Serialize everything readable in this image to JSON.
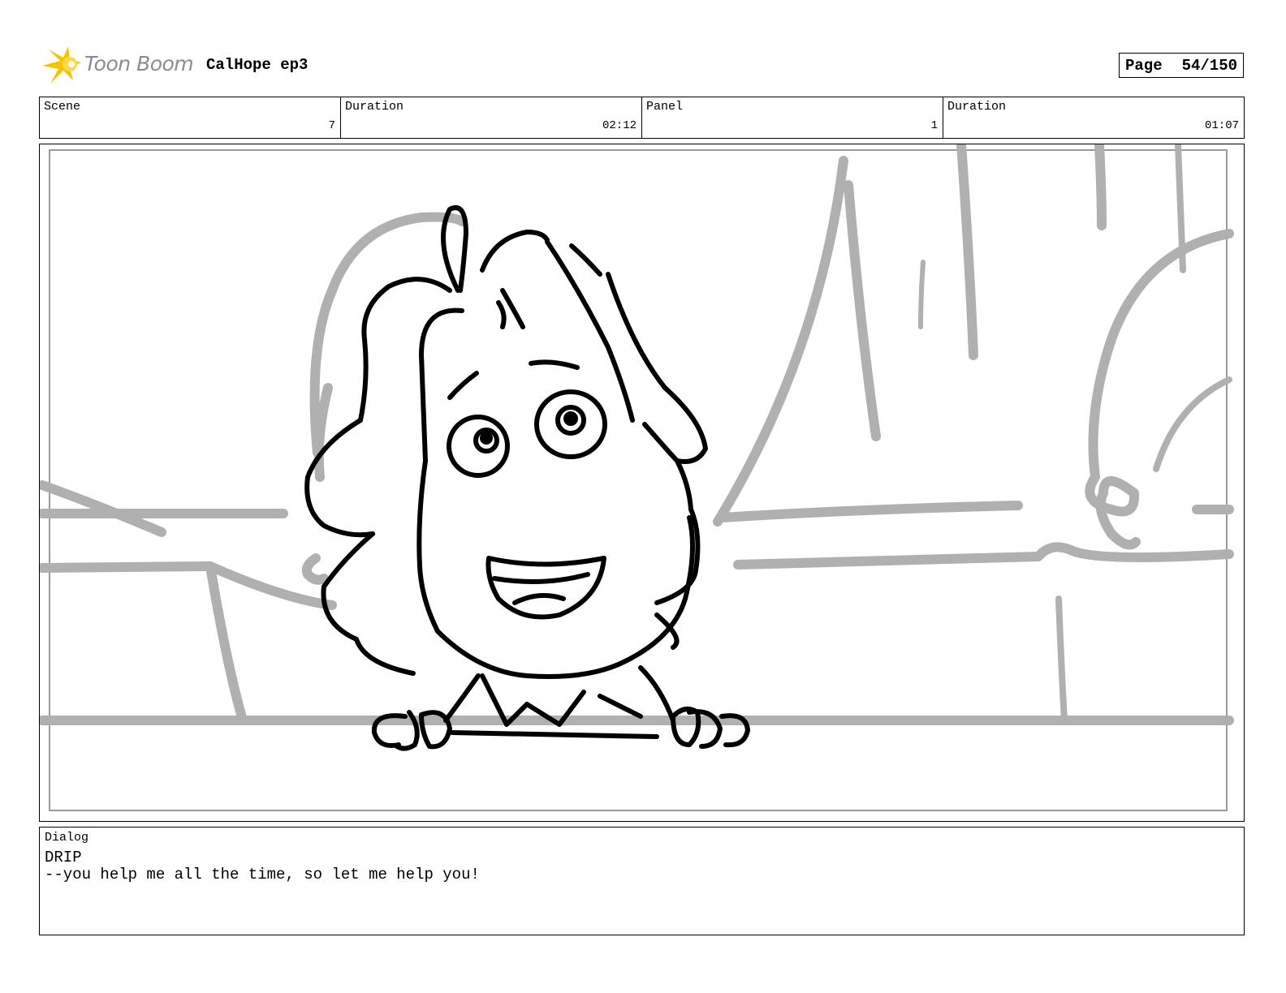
{
  "header": {
    "logo_text": "Toon Boom",
    "project_title": "CalHope ep3",
    "page_label": "Page",
    "page_number": "54/150"
  },
  "info": {
    "scene_label": "Scene",
    "scene_value": "7",
    "scene_duration_label": "Duration",
    "scene_duration_value": "02:12",
    "panel_label": "Panel",
    "panel_value": "1",
    "panel_duration_label": "Duration",
    "panel_duration_value": "01:07"
  },
  "dialog": {
    "label": "Dialog",
    "character": "DRIP",
    "line": "--you help me all the time, so let me help you!"
  },
  "colors": {
    "sketch_line": "#000000",
    "background_sketch": "#b0b0b0",
    "logo_star": "#f5c400"
  }
}
